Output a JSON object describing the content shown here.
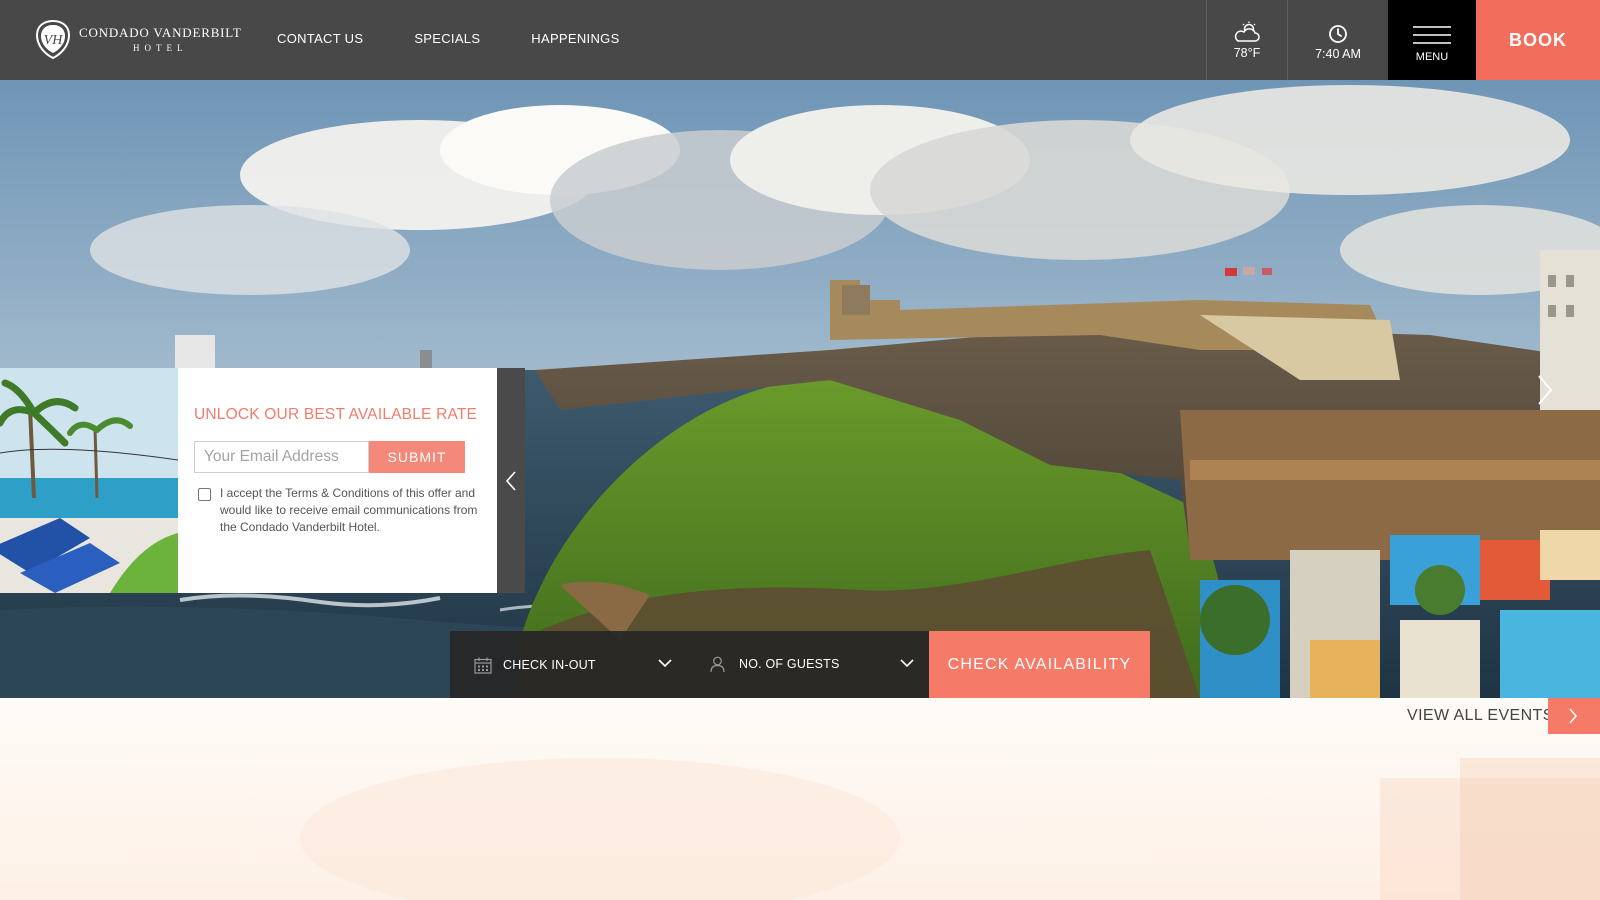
{
  "header": {
    "logo": {
      "line1": "Condado Vanderbilt",
      "line2": "HOTEL",
      "monogram": "VH"
    },
    "nav": [
      {
        "label": "CONTACT US"
      },
      {
        "label": "SPECIALS"
      },
      {
        "label": "HAPPENINGS"
      }
    ],
    "weather": {
      "icon": "cloud-sun-icon",
      "value": "78°F"
    },
    "time": {
      "icon": "clock-icon",
      "value": "7:40 AM"
    },
    "menu_label": "MENU",
    "book_label": "BOOK"
  },
  "offer": {
    "title": "UNLOCK OUR BEST AVAILABLE RATE",
    "email_placeholder": "Your Email Address",
    "submit_label": "SUBMIT",
    "terms": "I accept the Terms & Conditions of this offer and would like to receive email communications from the Condado Vanderbilt Hotel."
  },
  "booking": {
    "dates_label": "CHECK IN-OUT",
    "guests_label": "NO. OF GUESTS",
    "check_label": "CHECK AVAILABILITY"
  },
  "events": {
    "view_all_label": "VIEW ALL EVENTS"
  },
  "colors": {
    "accent": "#f57a67",
    "header_bg": "#484848",
    "menu_bg": "#000000"
  }
}
